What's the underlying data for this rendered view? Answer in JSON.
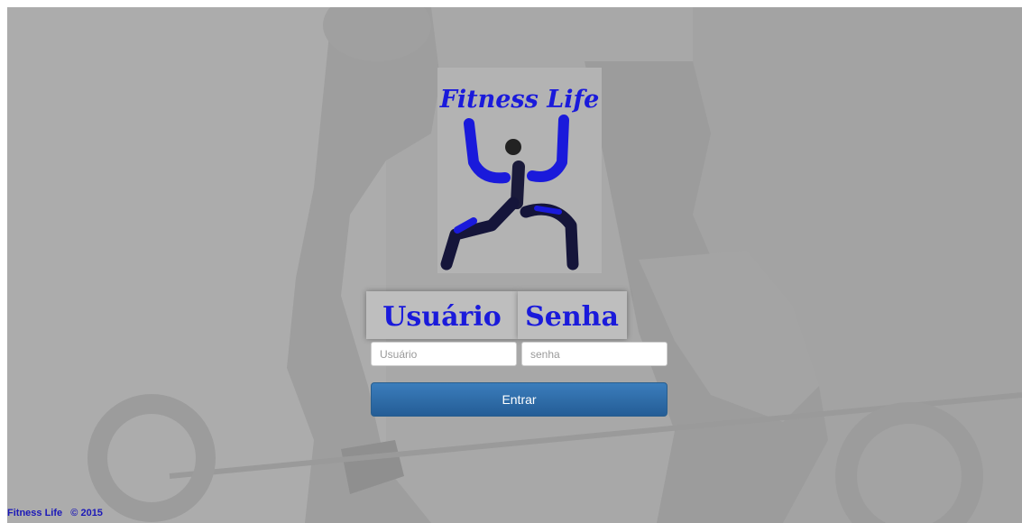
{
  "logo": {
    "text": "Fitness Life",
    "icon": "stick-figure-lifting-icon"
  },
  "labels": {
    "user": "Usuário",
    "password": "Senha"
  },
  "form": {
    "user_placeholder": "Usuário",
    "password_placeholder": "senha",
    "submit_label": "Entrar"
  },
  "footer": {
    "brand": "Fitness Life",
    "copyright": "© 2015"
  },
  "colors": {
    "logo_text": "#1a1adb",
    "button": "#2e6ca8",
    "footer_text": "#1c19b8"
  }
}
